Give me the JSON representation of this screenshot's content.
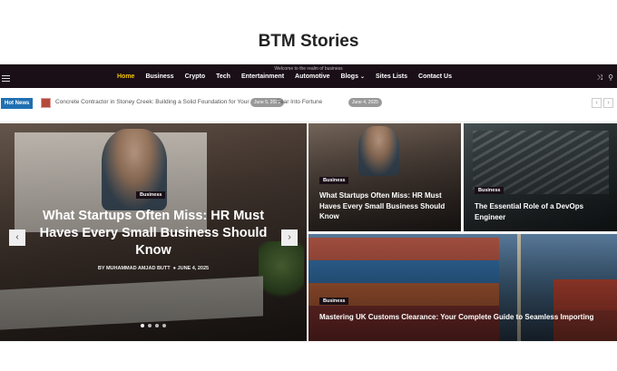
{
  "site": {
    "title": "BTM Stories"
  },
  "navbar": {
    "top_text": "Welcome to the realm of business",
    "items": [
      {
        "label": "Home",
        "active": true
      },
      {
        "label": "Business"
      },
      {
        "label": "Crypto"
      },
      {
        "label": "Tech"
      },
      {
        "label": "Entertainment"
      },
      {
        "label": "Automotive"
      },
      {
        "label": "Blogs",
        "has_dropdown": true
      },
      {
        "label": "Sites Lists"
      },
      {
        "label": "Contact Us"
      }
    ]
  },
  "ticker": {
    "badge": "Hot News",
    "item1": {
      "text": "Concrete Contractor in Stoney Creek: Building a Solid Foundation for Your Home",
      "date": "June 5, 2025"
    },
    "item2": {
      "text": "Fear Into Fortune",
      "date": "June 4, 2025"
    }
  },
  "featured": {
    "main": {
      "category": "Business",
      "title": "What Startups Often Miss: HR Must Haves Every Small Business Should Know",
      "author": "BY MUHAMMAD AMJAD BUTT",
      "date": "JUNE 4, 2025"
    },
    "top_left": {
      "category": "Business",
      "title": "What Startups Often Miss: HR Must Haves Every Small Business Should Know"
    },
    "top_right": {
      "category": "Business",
      "title": "The Essential Role of a DevOps Engineer"
    },
    "bottom": {
      "category": "Business",
      "title": "Mastering UK Customs Clearance: Your Complete Guide to Seamless Importing"
    }
  },
  "slider": {
    "dots": 4,
    "active_dot": 1
  },
  "colors": {
    "nav_bg": "#1a0f17",
    "active": "#f4c600",
    "hot_news": "#1f6fb2"
  },
  "icons": {
    "menu": "hamburger-icon",
    "shuffle": "shuffle-icon",
    "search": "search-icon",
    "prev": "chevron-left-icon",
    "next": "chevron-right-icon"
  }
}
